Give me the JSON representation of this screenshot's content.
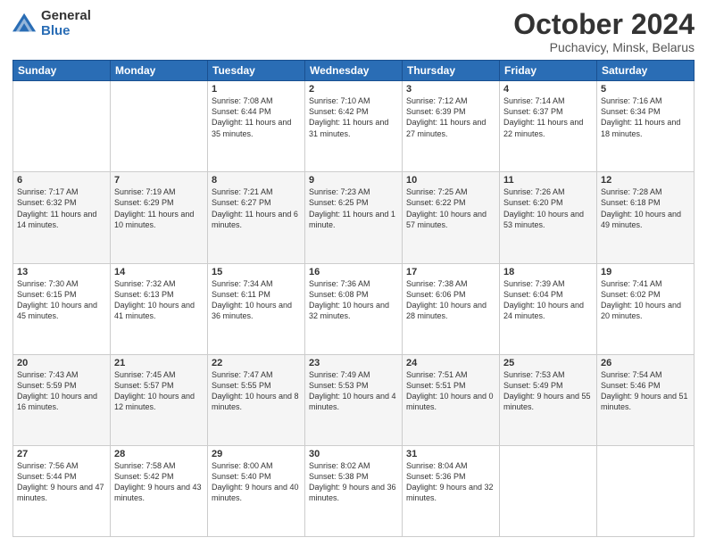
{
  "logo": {
    "general": "General",
    "blue": "Blue"
  },
  "header": {
    "month": "October 2024",
    "location": "Puchavicy, Minsk, Belarus"
  },
  "days_of_week": [
    "Sunday",
    "Monday",
    "Tuesday",
    "Wednesday",
    "Thursday",
    "Friday",
    "Saturday"
  ],
  "weeks": [
    [
      {
        "day": null,
        "sunrise": null,
        "sunset": null,
        "daylight": null
      },
      {
        "day": null,
        "sunrise": null,
        "sunset": null,
        "daylight": null
      },
      {
        "day": "1",
        "sunrise": "Sunrise: 7:08 AM",
        "sunset": "Sunset: 6:44 PM",
        "daylight": "Daylight: 11 hours and 35 minutes."
      },
      {
        "day": "2",
        "sunrise": "Sunrise: 7:10 AM",
        "sunset": "Sunset: 6:42 PM",
        "daylight": "Daylight: 11 hours and 31 minutes."
      },
      {
        "day": "3",
        "sunrise": "Sunrise: 7:12 AM",
        "sunset": "Sunset: 6:39 PM",
        "daylight": "Daylight: 11 hours and 27 minutes."
      },
      {
        "day": "4",
        "sunrise": "Sunrise: 7:14 AM",
        "sunset": "Sunset: 6:37 PM",
        "daylight": "Daylight: 11 hours and 22 minutes."
      },
      {
        "day": "5",
        "sunrise": "Sunrise: 7:16 AM",
        "sunset": "Sunset: 6:34 PM",
        "daylight": "Daylight: 11 hours and 18 minutes."
      }
    ],
    [
      {
        "day": "6",
        "sunrise": "Sunrise: 7:17 AM",
        "sunset": "Sunset: 6:32 PM",
        "daylight": "Daylight: 11 hours and 14 minutes."
      },
      {
        "day": "7",
        "sunrise": "Sunrise: 7:19 AM",
        "sunset": "Sunset: 6:29 PM",
        "daylight": "Daylight: 11 hours and 10 minutes."
      },
      {
        "day": "8",
        "sunrise": "Sunrise: 7:21 AM",
        "sunset": "Sunset: 6:27 PM",
        "daylight": "Daylight: 11 hours and 6 minutes."
      },
      {
        "day": "9",
        "sunrise": "Sunrise: 7:23 AM",
        "sunset": "Sunset: 6:25 PM",
        "daylight": "Daylight: 11 hours and 1 minute."
      },
      {
        "day": "10",
        "sunrise": "Sunrise: 7:25 AM",
        "sunset": "Sunset: 6:22 PM",
        "daylight": "Daylight: 10 hours and 57 minutes."
      },
      {
        "day": "11",
        "sunrise": "Sunrise: 7:26 AM",
        "sunset": "Sunset: 6:20 PM",
        "daylight": "Daylight: 10 hours and 53 minutes."
      },
      {
        "day": "12",
        "sunrise": "Sunrise: 7:28 AM",
        "sunset": "Sunset: 6:18 PM",
        "daylight": "Daylight: 10 hours and 49 minutes."
      }
    ],
    [
      {
        "day": "13",
        "sunrise": "Sunrise: 7:30 AM",
        "sunset": "Sunset: 6:15 PM",
        "daylight": "Daylight: 10 hours and 45 minutes."
      },
      {
        "day": "14",
        "sunrise": "Sunrise: 7:32 AM",
        "sunset": "Sunset: 6:13 PM",
        "daylight": "Daylight: 10 hours and 41 minutes."
      },
      {
        "day": "15",
        "sunrise": "Sunrise: 7:34 AM",
        "sunset": "Sunset: 6:11 PM",
        "daylight": "Daylight: 10 hours and 36 minutes."
      },
      {
        "day": "16",
        "sunrise": "Sunrise: 7:36 AM",
        "sunset": "Sunset: 6:08 PM",
        "daylight": "Daylight: 10 hours and 32 minutes."
      },
      {
        "day": "17",
        "sunrise": "Sunrise: 7:38 AM",
        "sunset": "Sunset: 6:06 PM",
        "daylight": "Daylight: 10 hours and 28 minutes."
      },
      {
        "day": "18",
        "sunrise": "Sunrise: 7:39 AM",
        "sunset": "Sunset: 6:04 PM",
        "daylight": "Daylight: 10 hours and 24 minutes."
      },
      {
        "day": "19",
        "sunrise": "Sunrise: 7:41 AM",
        "sunset": "Sunset: 6:02 PM",
        "daylight": "Daylight: 10 hours and 20 minutes."
      }
    ],
    [
      {
        "day": "20",
        "sunrise": "Sunrise: 7:43 AM",
        "sunset": "Sunset: 5:59 PM",
        "daylight": "Daylight: 10 hours and 16 minutes."
      },
      {
        "day": "21",
        "sunrise": "Sunrise: 7:45 AM",
        "sunset": "Sunset: 5:57 PM",
        "daylight": "Daylight: 10 hours and 12 minutes."
      },
      {
        "day": "22",
        "sunrise": "Sunrise: 7:47 AM",
        "sunset": "Sunset: 5:55 PM",
        "daylight": "Daylight: 10 hours and 8 minutes."
      },
      {
        "day": "23",
        "sunrise": "Sunrise: 7:49 AM",
        "sunset": "Sunset: 5:53 PM",
        "daylight": "Daylight: 10 hours and 4 minutes."
      },
      {
        "day": "24",
        "sunrise": "Sunrise: 7:51 AM",
        "sunset": "Sunset: 5:51 PM",
        "daylight": "Daylight: 10 hours and 0 minutes."
      },
      {
        "day": "25",
        "sunrise": "Sunrise: 7:53 AM",
        "sunset": "Sunset: 5:49 PM",
        "daylight": "Daylight: 9 hours and 55 minutes."
      },
      {
        "day": "26",
        "sunrise": "Sunrise: 7:54 AM",
        "sunset": "Sunset: 5:46 PM",
        "daylight": "Daylight: 9 hours and 51 minutes."
      }
    ],
    [
      {
        "day": "27",
        "sunrise": "Sunrise: 7:56 AM",
        "sunset": "Sunset: 5:44 PM",
        "daylight": "Daylight: 9 hours and 47 minutes."
      },
      {
        "day": "28",
        "sunrise": "Sunrise: 7:58 AM",
        "sunset": "Sunset: 5:42 PM",
        "daylight": "Daylight: 9 hours and 43 minutes."
      },
      {
        "day": "29",
        "sunrise": "Sunrise: 8:00 AM",
        "sunset": "Sunset: 5:40 PM",
        "daylight": "Daylight: 9 hours and 40 minutes."
      },
      {
        "day": "30",
        "sunrise": "Sunrise: 8:02 AM",
        "sunset": "Sunset: 5:38 PM",
        "daylight": "Daylight: 9 hours and 36 minutes."
      },
      {
        "day": "31",
        "sunrise": "Sunrise: 8:04 AM",
        "sunset": "Sunset: 5:36 PM",
        "daylight": "Daylight: 9 hours and 32 minutes."
      },
      {
        "day": null,
        "sunrise": null,
        "sunset": null,
        "daylight": null
      },
      {
        "day": null,
        "sunrise": null,
        "sunset": null,
        "daylight": null
      }
    ]
  ]
}
